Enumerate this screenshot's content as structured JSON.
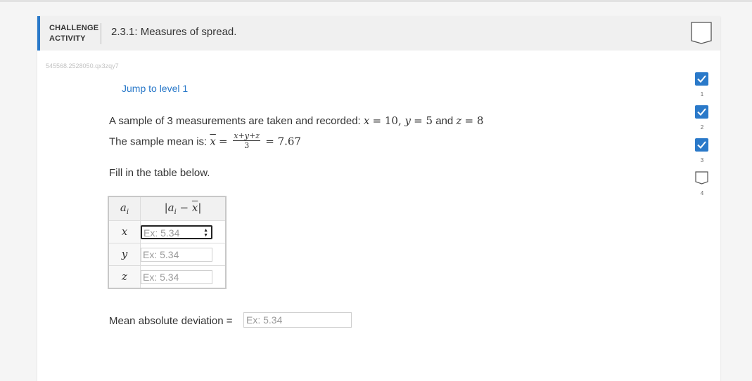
{
  "header": {
    "activity_type_line1": "CHALLENGE",
    "activity_type_line2": "ACTIVITY",
    "title": "2.3.1: Measures of spread."
  },
  "ref_id": "545568.2528050.qx3zqy7",
  "jump_link": "Jump to level 1",
  "problem": {
    "line1_prefix": "A sample of 3 measurements are taken and recorded:",
    "x_var": "x",
    "x_val": "10",
    "y_var": "y",
    "y_val": "5",
    "and_word": "and",
    "z_var": "z",
    "z_val": "8",
    "line2_prefix": "The sample mean is:",
    "mean_var": "x",
    "frac_num": "x+y+z",
    "frac_den": "3",
    "mean_val": "7.67"
  },
  "instructions": "Fill in the table below.",
  "table": {
    "header_a": "a",
    "header_a_sub": "i",
    "header_b_pre": "|a",
    "header_b_sub": "i",
    "header_b_mid": " − ",
    "header_b_x": "x",
    "header_b_post": "|",
    "rows": [
      {
        "label": "x",
        "placeholder": "Ex: 5.34"
      },
      {
        "label": "y",
        "placeholder": "Ex: 5.34"
      },
      {
        "label": "z",
        "placeholder": "Ex: 5.34"
      }
    ]
  },
  "mad": {
    "label": "Mean absolute deviation =",
    "placeholder": "Ex: 5.34"
  },
  "levels": [
    {
      "num": "1",
      "status": "completed"
    },
    {
      "num": "2",
      "status": "completed"
    },
    {
      "num": "3",
      "status": "completed"
    },
    {
      "num": "4",
      "status": "incomplete"
    }
  ],
  "colors": {
    "accent": "#2a79c9",
    "level_complete": "#2a79c9"
  }
}
